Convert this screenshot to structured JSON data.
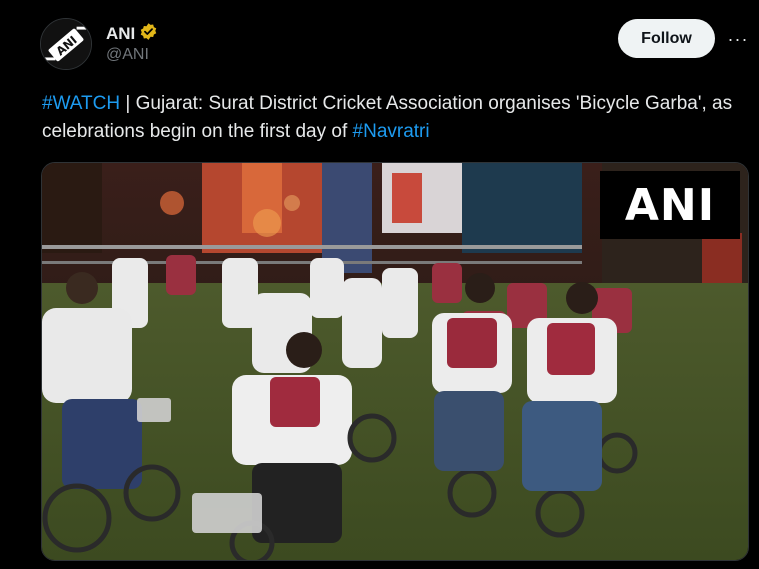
{
  "author": {
    "display_name": "ANI",
    "handle": "@ANI",
    "verified_icon": "verified-badge-icon",
    "avatar_text": "ANI"
  },
  "actions": {
    "follow_label": "Follow",
    "more_label": "···"
  },
  "tweet": {
    "hashtag_1": "#WATCH",
    "text_1": " | Gujarat: Surat District Cricket Association organises 'Bicycle Garba', as celebrations begin on the first day of ",
    "hashtag_2": "#Navratri"
  },
  "media": {
    "watermark": "ANI"
  },
  "colors": {
    "link": "#1d9bf0",
    "verified": "#e2b719",
    "follow_bg": "#eff3f4"
  }
}
